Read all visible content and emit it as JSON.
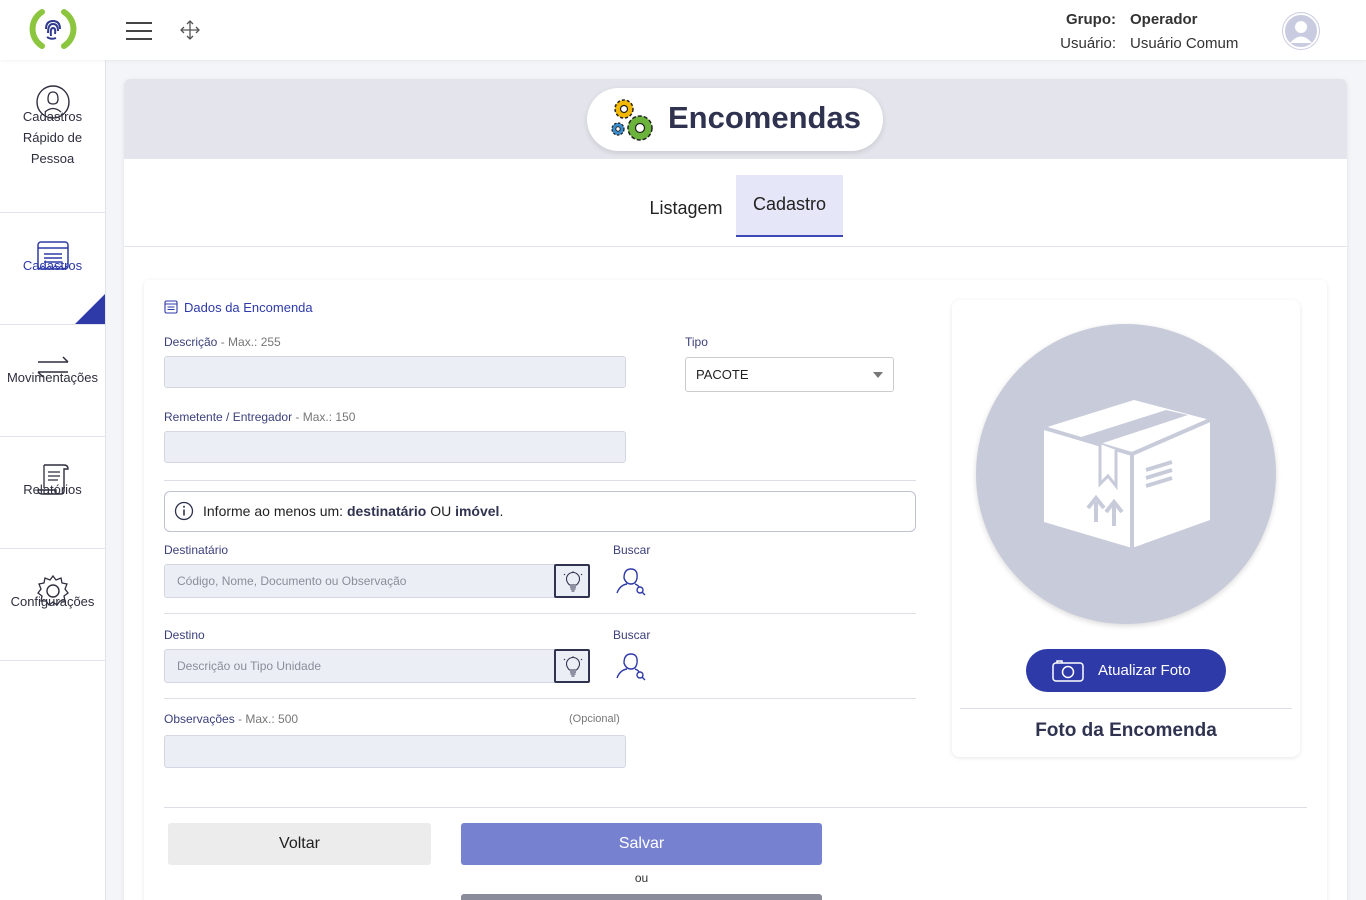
{
  "header": {
    "group_label": "Grupo:",
    "group_value": "Operador",
    "user_label": "Usuário:",
    "user_value": "Usuário Comum"
  },
  "sidebar": {
    "items": [
      {
        "label_lines": [
          "Cadastros",
          "Rápido de",
          "Pessoa"
        ]
      },
      {
        "label": "Cadastros",
        "active": true
      },
      {
        "label": "Movimentações"
      },
      {
        "label": "Relatórios"
      },
      {
        "label": "Configurações"
      }
    ]
  },
  "page": {
    "title": "Encomendas",
    "tabs": [
      "Listagem",
      "Cadastro"
    ],
    "active_tab": "Cadastro"
  },
  "form": {
    "section_title": "Dados da Encomenda",
    "descricao": {
      "label": "Descrição",
      "hint": "- Max.: 255",
      "value": ""
    },
    "tipo": {
      "label": "Tipo",
      "value": "PACOTE"
    },
    "remetente": {
      "label": "Remetente / Entregador",
      "hint": "- Max.: 150",
      "value": ""
    },
    "notice": {
      "prefix": "Informe ao menos um:",
      "term1": "destinatário",
      "mid": "OU",
      "term2": "imóvel",
      "suffix": "."
    },
    "destinatario": {
      "label": "Destinatário",
      "placeholder": "Código, Nome, Documento ou Observação",
      "search_label": "Buscar"
    },
    "destino": {
      "label": "Destino",
      "placeholder": "Descrição ou Tipo Unidade",
      "search_label": "Buscar"
    },
    "observacoes": {
      "label": "Observações",
      "hint": "- Max.: 500",
      "optional": "(Opcional)",
      "value": ""
    }
  },
  "photo": {
    "button_label": "Atualizar Foto",
    "caption": "Foto da Encomenda"
  },
  "actions": {
    "back_label": "Voltar",
    "save_label": "Salvar",
    "or_label": "ou"
  },
  "colors": {
    "primary": "#2e3aa8",
    "save_button": "#7681d0",
    "logo_green": "#8cc63f"
  }
}
